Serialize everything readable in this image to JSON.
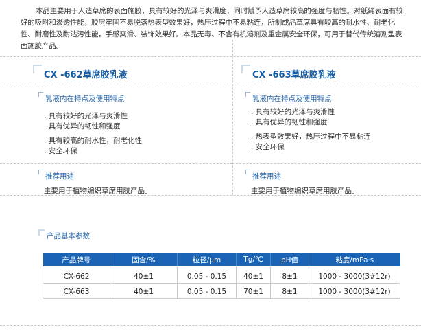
{
  "intro": "本品主要用于人造草席的表面施胶，具有较好的光泽与爽滑度，同时赋予人造草席较高的强度与韧性。对纸绳表面有较好的吸附和渗透性能，胶层牢固不易脱落热表型效果好，热压过程中不易粘连，所制成品草席具有较高的耐水性、耐老化性、耐磨性及耐沾污性能，手感爽滑、装饰效果好。本品无毒、不含有机溶剂及重金属安全环保，可用于替代传统溶剂型表面施胶产品。",
  "products": [
    {
      "title": "CX -662草席胶乳液",
      "feature_heading": "乳液内在特点及使用特点",
      "features": [
        ". 具有较好的光泽与爽滑性",
        ". 具有优异的韧性和强度",
        ". 具有较高的耐水性，耐老化性",
        ". 安全环保"
      ],
      "usage_heading": "推荐用途",
      "usage": "主要用于植物编织草席用胶产品。"
    },
    {
      "title": "CX -663草席胶乳液",
      "feature_heading": "乳液内在特点及使用特点",
      "features": [
        ". 具有较好的光泽与爽滑性",
        ". 具有优异的韧性和强度",
        ". 热表型效果好，热压过程中不易粘连",
        ". 安全环保"
      ],
      "usage_heading": "推荐用途",
      "usage": "主要用于植物编织草席用胶产品。"
    }
  ],
  "params": {
    "heading": "产品基本参数",
    "headers": [
      "产品牌号",
      "固含/%",
      "粒径/μm",
      "Tg/℃",
      "pH值",
      "粘度/mPa·s"
    ],
    "rows": [
      [
        "CX-662",
        "40±1",
        "0.05 - 0.15",
        "40±1",
        "8±1",
        "1000 - 3000(3#12r)"
      ],
      [
        "CX-663",
        "40±1",
        "0.05 - 0.15",
        "70±1",
        "8±1",
        "1000 - 3000(3#12r)"
      ]
    ]
  },
  "colors": {
    "accent": "#1b63b5",
    "title": "#1a5fa3",
    "divider": "#c8c8c8"
  }
}
